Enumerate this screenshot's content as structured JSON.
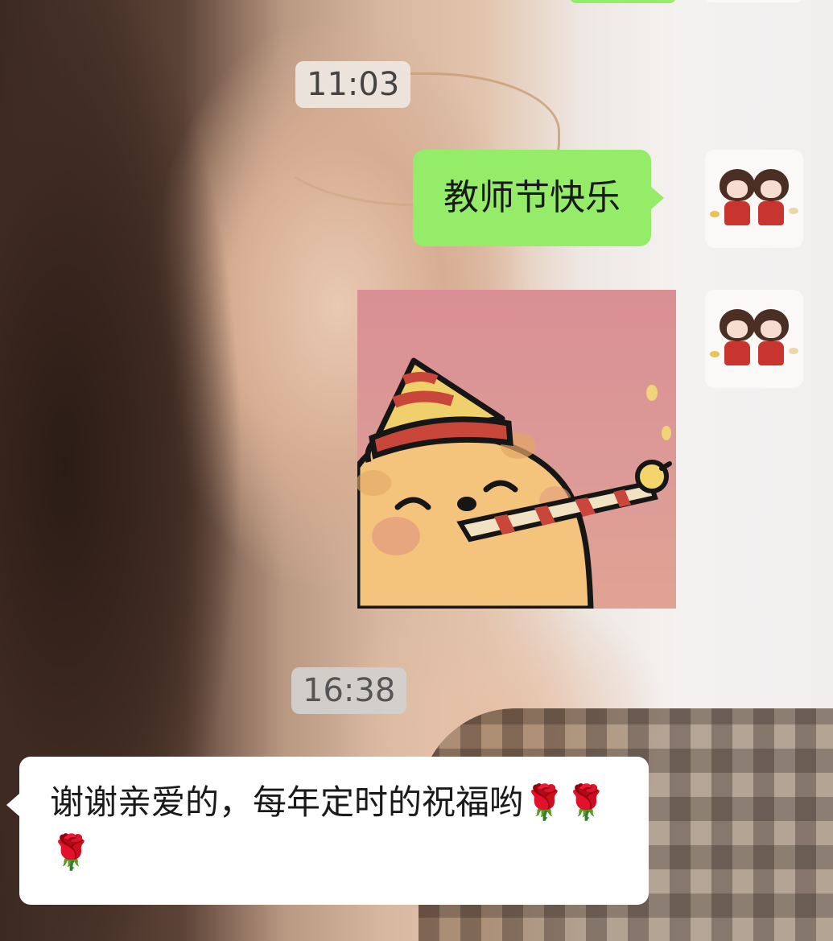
{
  "chat": {
    "messages": [
      {
        "type": "timestamp",
        "text": "11:03"
      },
      {
        "type": "text",
        "side": "right",
        "text": "教师节快乐"
      },
      {
        "type": "sticker",
        "side": "right"
      },
      {
        "type": "timestamp",
        "text": "16:38"
      },
      {
        "type": "text",
        "side": "left",
        "text": "谢谢亲爱的，每年定时的祝福哟🌹🌹🌹"
      }
    ]
  },
  "colors": {
    "outgoing_bubble": "#95ec69",
    "incoming_bubble": "#ffffff",
    "timestamp_bg": "#eee8e2"
  },
  "icons": {
    "avatar": "chibi-couple-avatar-icon",
    "sticker": "party-bear-sticker-icon"
  }
}
